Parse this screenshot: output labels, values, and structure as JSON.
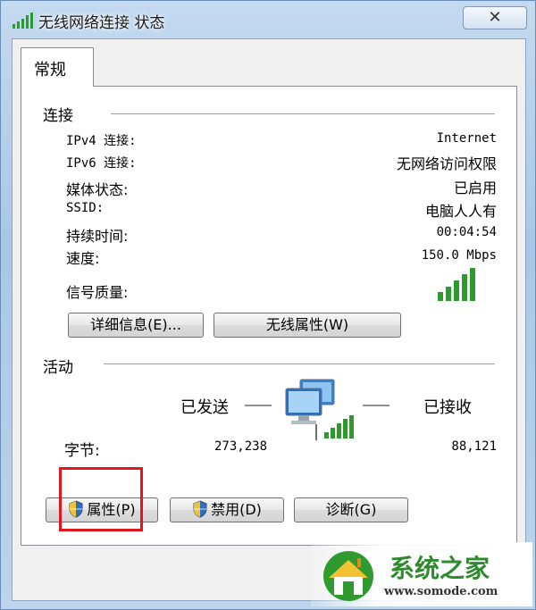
{
  "window": {
    "title": "无线网络连接 状态",
    "close_label": "✕"
  },
  "tabs": [
    {
      "label": "常规"
    }
  ],
  "connection": {
    "group_label": "连接",
    "rows": [
      {
        "label": "IPv4 连接:",
        "value": "Internet"
      },
      {
        "label": "IPv6 连接:",
        "value": "无网络访问权限"
      },
      {
        "label": "媒体状态:",
        "value": "已启用"
      },
      {
        "label": "SSID:",
        "value": "电脑人人有"
      },
      {
        "label": "持续时间:",
        "value": "00:04:54"
      },
      {
        "label": "速度:",
        "value": "150.0 Mbps"
      }
    ],
    "signal_label": "信号质量:",
    "signal_bars_lit": 5,
    "signal_bars_total": 5,
    "details_button": "详细信息(E)...",
    "wireless_props_button": "无线属性(W)"
  },
  "activity": {
    "group_label": "活动",
    "sent_label": "已发送",
    "received_label": "已接收",
    "bytes_label": "字节:",
    "bytes_sent": "273,238",
    "bytes_received": "88,121"
  },
  "buttons": {
    "properties": "属性(P)",
    "disable": "禁用(D)",
    "diagnose": "诊断(G)"
  },
  "watermark": {
    "text": "系统之家",
    "url": "www.somode.com"
  },
  "colors": {
    "signal_green": "#2e9a2e",
    "highlight_red": "#e3161d",
    "accent_blue": "#1e5fb0"
  },
  "icons": [
    "signal-icon",
    "close-icon",
    "network-computers-icon",
    "shield-icon",
    "house-logo-icon"
  ]
}
